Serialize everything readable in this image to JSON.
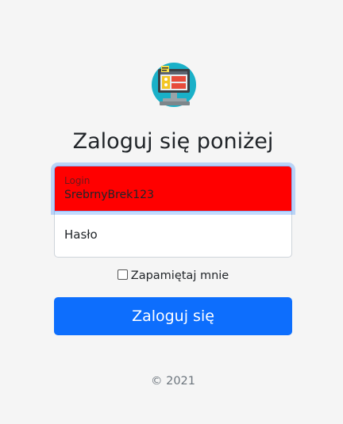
{
  "form": {
    "heading": "Zaloguj się poniżej",
    "login": {
      "label": "Login",
      "value": "SrebrnyBrek123",
      "background": "#ff0000"
    },
    "password": {
      "label": "Hasło"
    },
    "remember": {
      "label": "Zapamiętaj mnie",
      "checked": false
    },
    "submit_label": "Zaloguj się",
    "footer": "© 2021"
  },
  "colors": {
    "primary": "#0d6efd",
    "page_background": "#f5f5f5"
  },
  "icons": {
    "logo": "computer-workstation-icon"
  }
}
